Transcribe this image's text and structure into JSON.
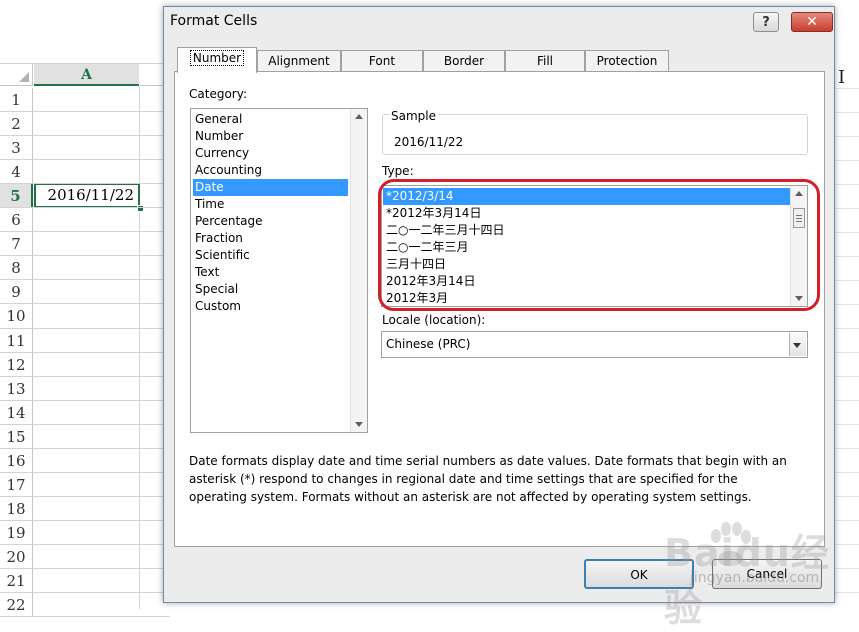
{
  "spreadsheet": {
    "column_header": "A",
    "row_headers": [
      "1",
      "2",
      "3",
      "4",
      "5",
      "6",
      "7",
      "8",
      "9",
      "10",
      "11",
      "12",
      "13",
      "14",
      "15",
      "16",
      "17",
      "18",
      "19",
      "20",
      "21",
      "22"
    ],
    "selected_row": "5",
    "active_cell_value": "2016/11/22",
    "accent_color": "#217346"
  },
  "dialog": {
    "title": "Format Cells",
    "help_glyph": "?",
    "close_glyph": "✕",
    "tabs": [
      {
        "label": "Number",
        "active": true
      },
      {
        "label": "Alignment"
      },
      {
        "label": "Font"
      },
      {
        "label": "Border"
      },
      {
        "label": "Fill"
      },
      {
        "label": "Protection"
      }
    ],
    "category_label": "Category:",
    "categories": [
      "General",
      "Number",
      "Currency",
      "Accounting",
      "Date",
      "Time",
      "Percentage",
      "Fraction",
      "Scientific",
      "Text",
      "Special",
      "Custom"
    ],
    "selected_category": "Date",
    "sample_label": "Sample",
    "sample_value": "2016/11/22",
    "type_label": "Type:",
    "types": [
      "*2012/3/14",
      "*2012年3月14日",
      "二○一二年三月十四日",
      "二○一二年三月",
      "三月十四日",
      "2012年3月14日",
      "2012年3月"
    ],
    "selected_type": "*2012/3/14",
    "locale_label": "Locale (location):",
    "locale_value": "Chinese (PRC)",
    "description": "Date formats display date and time serial numbers as date values.  Date formats that begin with an asterisk (*) respond to changes in regional date and time settings that are specified for the operating system. Formats without an asterisk are not affected by operating system settings.",
    "ok_label": "OK",
    "cancel_label": "Cancel",
    "highlight_color": "#d21f2a",
    "selection_color": "#3399ff"
  },
  "watermark": {
    "brand": "Baidu经验",
    "url": "jingyan.baidu.com"
  }
}
